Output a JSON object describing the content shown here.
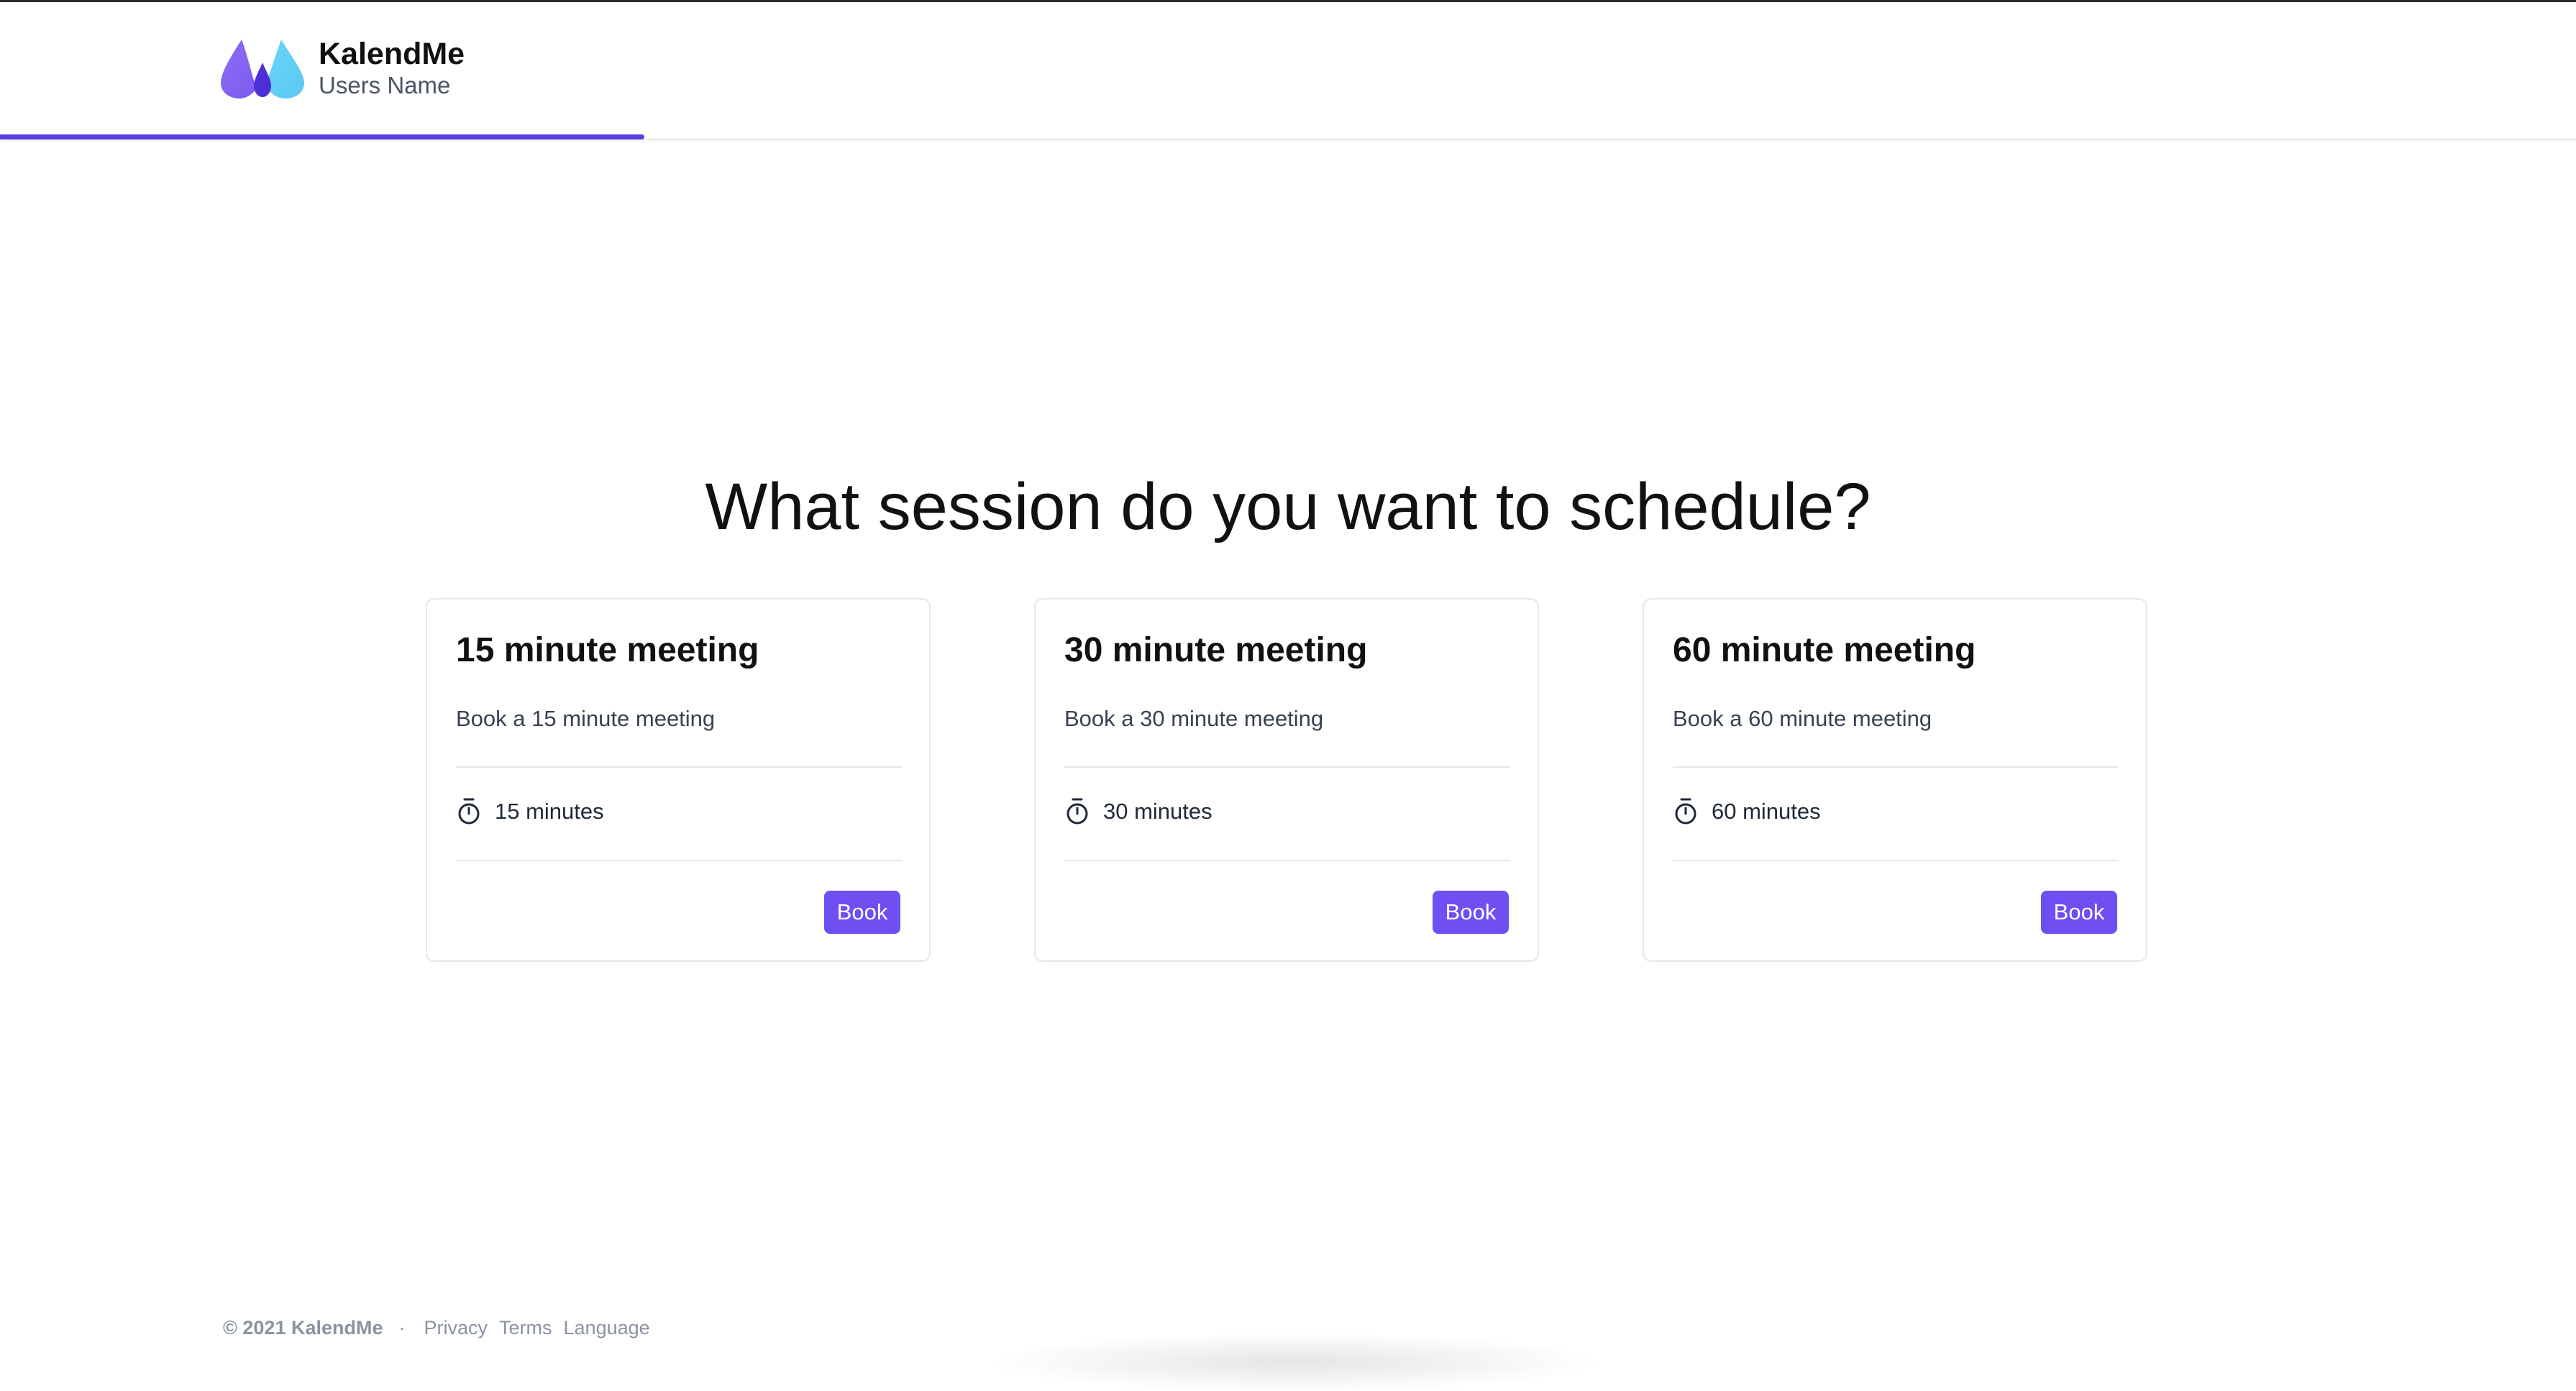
{
  "header": {
    "brand_name": "KalendMe",
    "user_name": "Users Name",
    "progress_percent": 25,
    "accent_color": "#5b3fe0"
  },
  "main": {
    "title": "What session do you want to schedule?",
    "cards": [
      {
        "title": "15 minute meeting",
        "description": "Book a 15 minute meeting",
        "duration": "15 minutes",
        "duration_icon": "timer-icon",
        "button_label": "Book"
      },
      {
        "title": "30 minute meeting",
        "description": "Book a 30 minute meeting",
        "duration": "30 minutes",
        "duration_icon": "timer-icon",
        "button_label": "Book"
      },
      {
        "title": "60 minute meeting",
        "description": "Book a 60 minute meeting",
        "duration": "60 minutes",
        "duration_icon": "timer-icon",
        "button_label": "Book"
      }
    ],
    "button_color": "#6d4ff2"
  },
  "footer": {
    "copyright": "© 2021 KalendMe",
    "separator": "·",
    "links": [
      "Privacy",
      "Terms",
      "Language"
    ]
  }
}
